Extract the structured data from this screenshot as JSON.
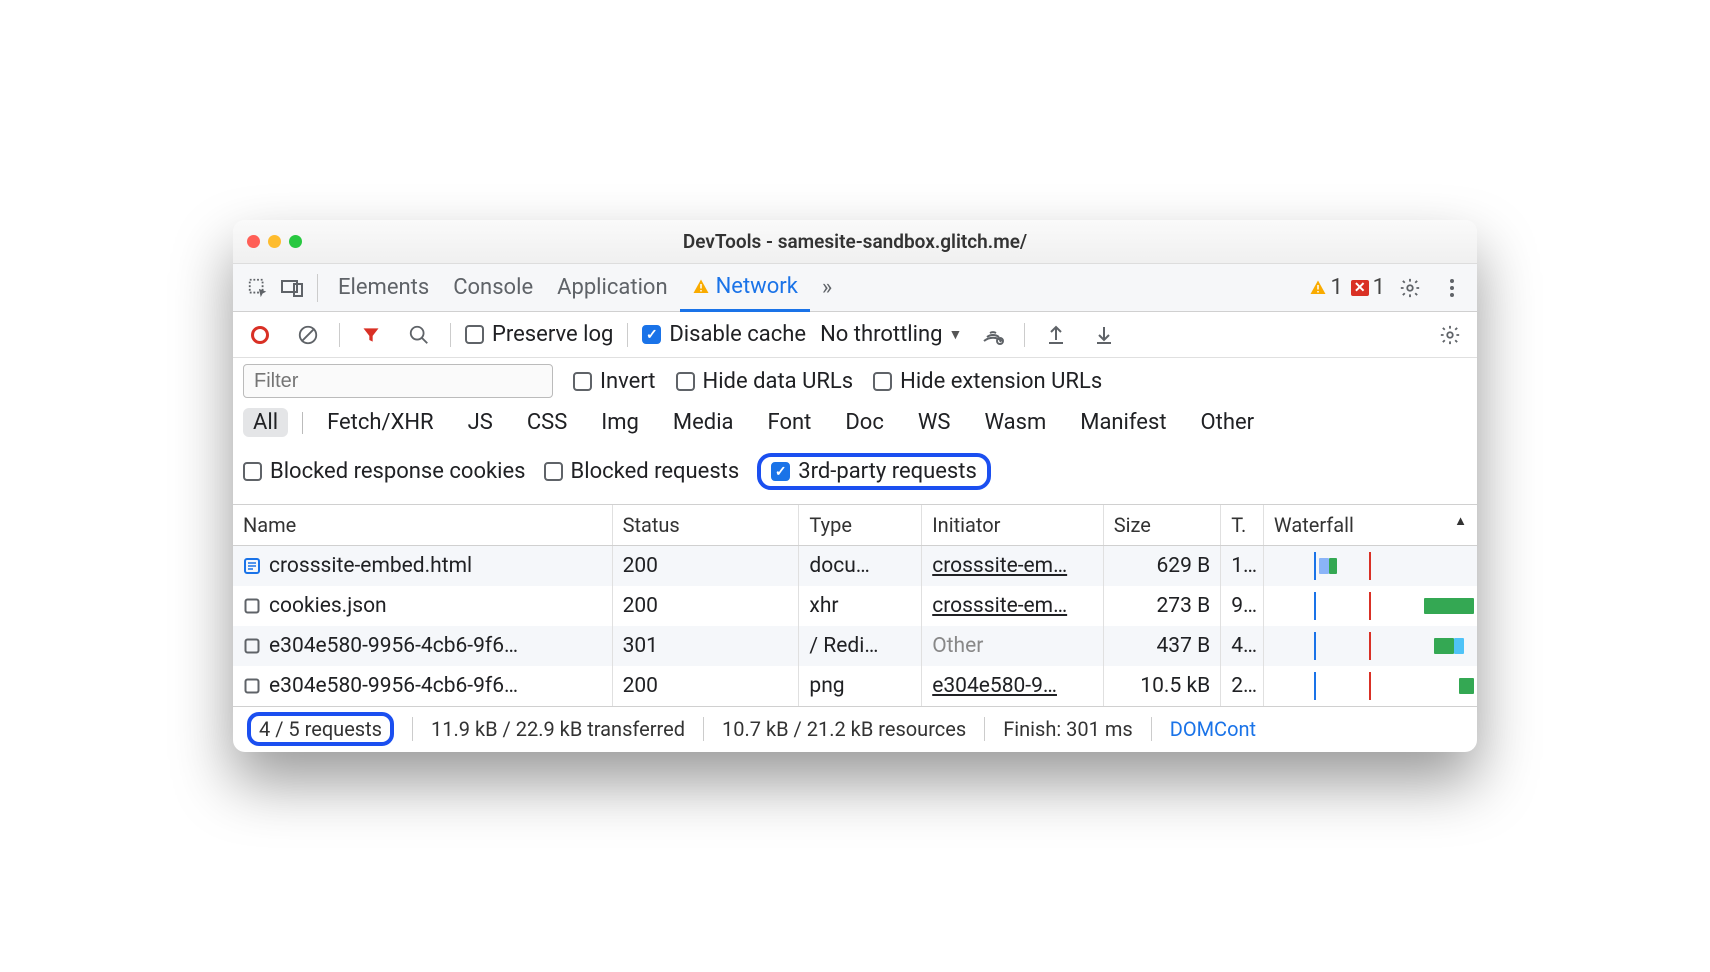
{
  "title": "DevTools - samesite-sandbox.glitch.me/",
  "tabs": {
    "items": [
      "Elements",
      "Console",
      "Application",
      "Network"
    ],
    "active": "Network",
    "more": "»",
    "warn_count": "1",
    "err_count": "1"
  },
  "toolbar": {
    "preserve_log": "Preserve log",
    "disable_cache": "Disable cache",
    "throttling": "No throttling"
  },
  "filter": {
    "placeholder": "Filter",
    "invert": "Invert",
    "hide_data": "Hide data URLs",
    "hide_ext": "Hide extension URLs"
  },
  "types": [
    "All",
    "Fetch/XHR",
    "JS",
    "CSS",
    "Img",
    "Media",
    "Font",
    "Doc",
    "WS",
    "Wasm",
    "Manifest",
    "Other"
  ],
  "types_active": "All",
  "more_filters": {
    "blocked_cookies": "Blocked response cookies",
    "blocked_req": "Blocked requests",
    "third_party": "3rd-party requests"
  },
  "columns": {
    "name": "Name",
    "status": "Status",
    "type": "Type",
    "initiator": "Initiator",
    "size": "Size",
    "time": "T.",
    "waterfall": "Waterfall"
  },
  "rows": [
    {
      "name": "crosssite-embed.html",
      "status": "200",
      "type": "docu…",
      "initiator": "crosssite-em…",
      "initiator_link": true,
      "size": "629 B",
      "time": "1..",
      "icon": "doc",
      "wf": {
        "bars": [
          {
            "l": 45,
            "w": 10,
            "c": "#8ab4f8"
          },
          {
            "l": 55,
            "w": 8,
            "c": "#34a853"
          }
        ]
      }
    },
    {
      "name": "cookies.json",
      "status": "200",
      "type": "xhr",
      "initiator": "crosssite-em…",
      "initiator_link": true,
      "size": "273 B",
      "time": "9..",
      "icon": "box",
      "wf": {
        "bars": [
          {
            "l": 150,
            "w": 50,
            "c": "#34a853"
          }
        ]
      }
    },
    {
      "name": "e304e580-9956-4cb6-9f6…",
      "status": "301",
      "type": "/ Redi…",
      "initiator": "Other",
      "initiator_link": false,
      "size": "437 B",
      "time": "4..",
      "icon": "box",
      "wf": {
        "bars": [
          {
            "l": 160,
            "w": 20,
            "c": "#34a853"
          },
          {
            "l": 180,
            "w": 10,
            "c": "#4fc3f7"
          }
        ]
      }
    },
    {
      "name": "e304e580-9956-4cb6-9f6…",
      "status": "200",
      "type": "png",
      "initiator": "e304e580-9…",
      "initiator_link": true,
      "size": "10.5 kB",
      "time": "2..",
      "icon": "box",
      "wf": {
        "bars": [
          {
            "l": 185,
            "w": 15,
            "c": "#34a853"
          }
        ]
      }
    }
  ],
  "statusbar": {
    "requests": "4 / 5 requests",
    "transferred": "11.9 kB / 22.9 kB transferred",
    "resources": "10.7 kB / 21.2 kB resources",
    "finish": "Finish: 301 ms",
    "dom": "DOMCont"
  }
}
